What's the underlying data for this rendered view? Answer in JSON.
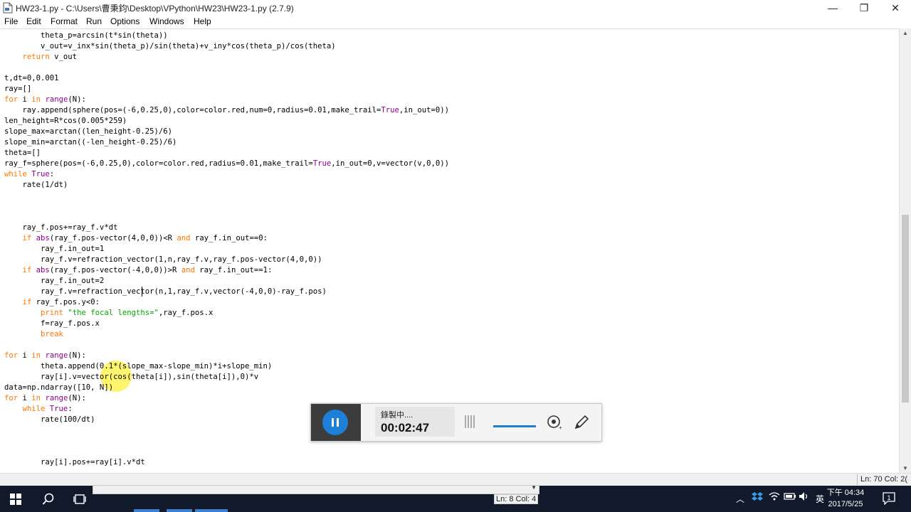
{
  "window": {
    "title": "HW23-1.py - C:\\Users\\曹秉鈞\\Desktop\\VPython\\HW23\\HW23-1.py (2.7.9)",
    "minimize": "—",
    "restore": "❐",
    "close": "✕"
  },
  "menu": [
    "File",
    "Edit",
    "Format",
    "Run",
    "Options",
    "Windows",
    "Help"
  ],
  "code_lines": [
    "        theta_p=arcsin(t*sin(theta))",
    "        v_out=v_inx*sin(theta_p)/sin(theta)+v_iny*cos(theta_p)/cos(theta)",
    "    return v_out",
    "",
    "t,dt=0,0.001",
    "ray=[]",
    "for i in range(N):",
    "    ray.append(sphere(pos=(-6,0.25,0),color=color.red,num=0,radius=0.01,make_trail=True,in_out=0))",
    "len_height=R*cos(0.005*259)",
    "slope_max=arctan((len_height-0.25)/6)",
    "slope_min=arctan((-len_height-0.25)/6)",
    "theta=[]",
    "ray_f=sphere(pos=(-6,0.25,0),color=color.red,radius=0.01,make_trail=True,in_out=0,v=vector(v,0,0))",
    "while True:",
    "    rate(1/dt)",
    "",
    "",
    "",
    "    ray_f.pos+=ray_f.v*dt",
    "    if abs(ray_f.pos-vector(4,0,0))<R and ray_f.in_out==0:",
    "        ray_f.in_out=1",
    "        ray_f.v=refraction_vector(1,n,ray_f.v,ray_f.pos-vector(4,0,0))",
    "    if abs(ray_f.pos-vector(-4,0,0))>R and ray_f.in_out==1:",
    "        ray_f.in_out=2",
    "        ray_f.v=refraction_vector(n,1,ray_f.v,vector(-4,0,0)-ray_f.pos)",
    "    if ray_f.pos.y<0:",
    "        print \"the focal lengths=\",ray_f.pos.x",
    "        f=ray_f.pos.x",
    "        break",
    "",
    "for i in range(N):",
    "        theta.append(0.1*(slope_max-slope_min)*i+slope_min)",
    "        ray[i].v=vector(cos(theta[i]),sin(theta[i]),0)*v",
    "data=np.ndarray([10, N])",
    "for i in range(N):",
    "    while True:",
    "        rate(100/dt)",
    "",
    "",
    "",
    "        ray[i].pos+=ray[i].v*dt"
  ],
  "keywords": [
    "for",
    "in",
    "while",
    "if",
    "and",
    "return",
    "break",
    "print"
  ],
  "builtins": [
    "range",
    "abs",
    "True"
  ],
  "status": {
    "ln_col": "Ln: 70 Col: 2(",
    "inner_ln_col": "Ln: 8 Col: 4"
  },
  "recorder": {
    "status": "錄製中....",
    "time": "00:02:47"
  },
  "taskbar": {
    "time": "下午 04:34",
    "date": "2017/5/25",
    "ime": "英"
  },
  "colors": {
    "keyword": "#ff7700",
    "builtin": "#900090",
    "string": "#00aa00",
    "taskbar": "#101a2b",
    "accent": "#1d7fd6"
  }
}
